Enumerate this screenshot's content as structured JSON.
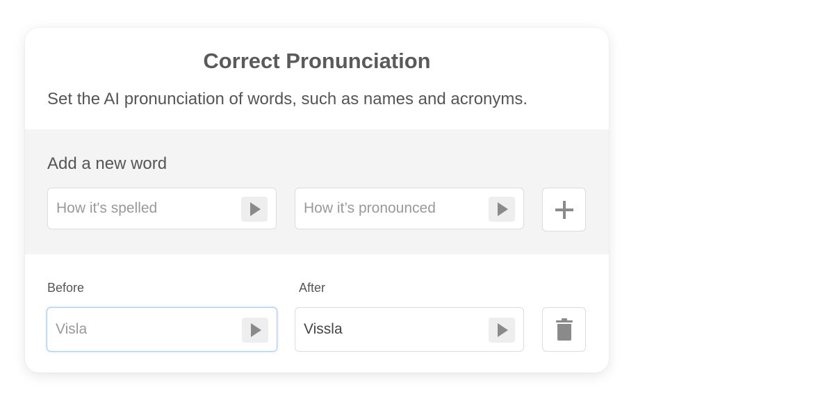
{
  "header": {
    "title": "Correct Pronunciation",
    "subtitle": "Set the AI pronunciation of words, such as names and acronyms."
  },
  "add_word": {
    "title": "Add a new word",
    "spelled_placeholder": "How it's spelled",
    "pronounced_placeholder": "How it’s pronounced",
    "play_icon": "play-icon",
    "add_icon": "plus-icon"
  },
  "entries": {
    "before_label": "Before",
    "after_label": "After",
    "rows": [
      {
        "before_placeholder": "Visla",
        "after_value": "Vissla",
        "delete_icon": "trash-icon"
      }
    ]
  },
  "colors": {
    "focus_border": "#a8cdf0",
    "section_bg": "#f4f4f4",
    "icon_gray": "#8a8a8a"
  }
}
